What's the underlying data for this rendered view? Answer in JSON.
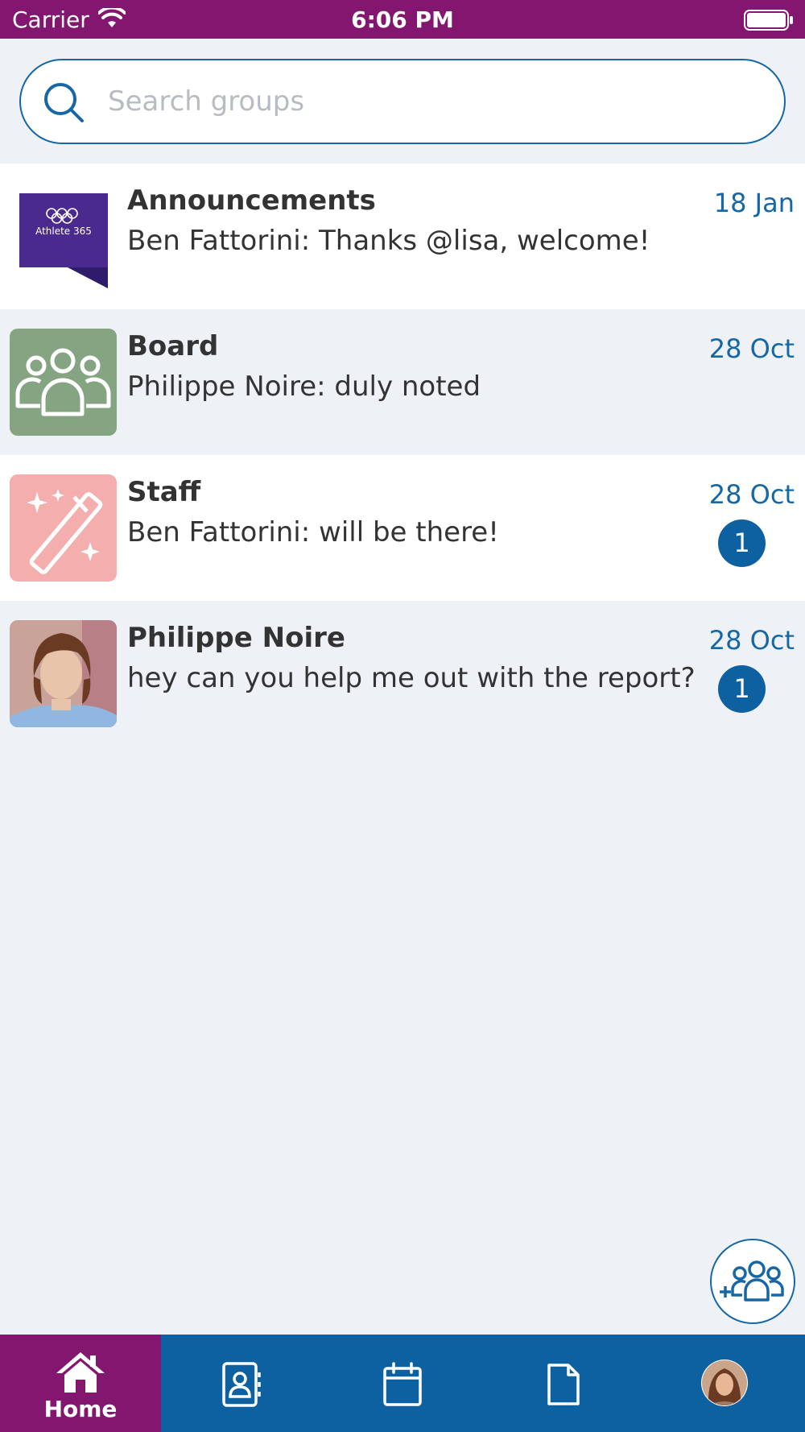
{
  "status_bar": {
    "carrier": "Carrier",
    "time": "6:06 PM"
  },
  "search": {
    "placeholder": "Search groups",
    "value": ""
  },
  "groups": [
    {
      "name": "Announcements",
      "preview": "Ben Fattorini: Thanks @lisa, welcome!",
      "date": "18 Jan",
      "icon": "athlete-365-logo",
      "logo_text": "Athlete 365"
    },
    {
      "name": "Board",
      "preview": "Philippe Noire: duly noted",
      "date": "28 Oct",
      "icon": "people-group-icon",
      "color": "#85a582"
    },
    {
      "name": "Staff",
      "preview": "Ben Fattorini: will be there!",
      "date": "28 Oct",
      "unread": "1",
      "icon": "magic-wand-icon",
      "color": "#f4aeae"
    },
    {
      "name": "Philippe Noire",
      "preview": "hey can you help me out with the report?",
      "date": "28 Oct",
      "unread": "1",
      "icon": "user-photo"
    }
  ],
  "nav": [
    {
      "label": "Home",
      "icon": "home-icon",
      "active": true
    },
    {
      "label": "",
      "icon": "contacts-icon"
    },
    {
      "label": "",
      "icon": "calendar-icon"
    },
    {
      "label": "",
      "icon": "document-icon"
    },
    {
      "label": "",
      "icon": "profile-avatar"
    }
  ],
  "colors": {
    "status_bar": "#83166f",
    "accent": "#1667a6",
    "nav_bg": "#0e61a1",
    "nav_active": "#83166f",
    "badge": "#0e61a1"
  }
}
